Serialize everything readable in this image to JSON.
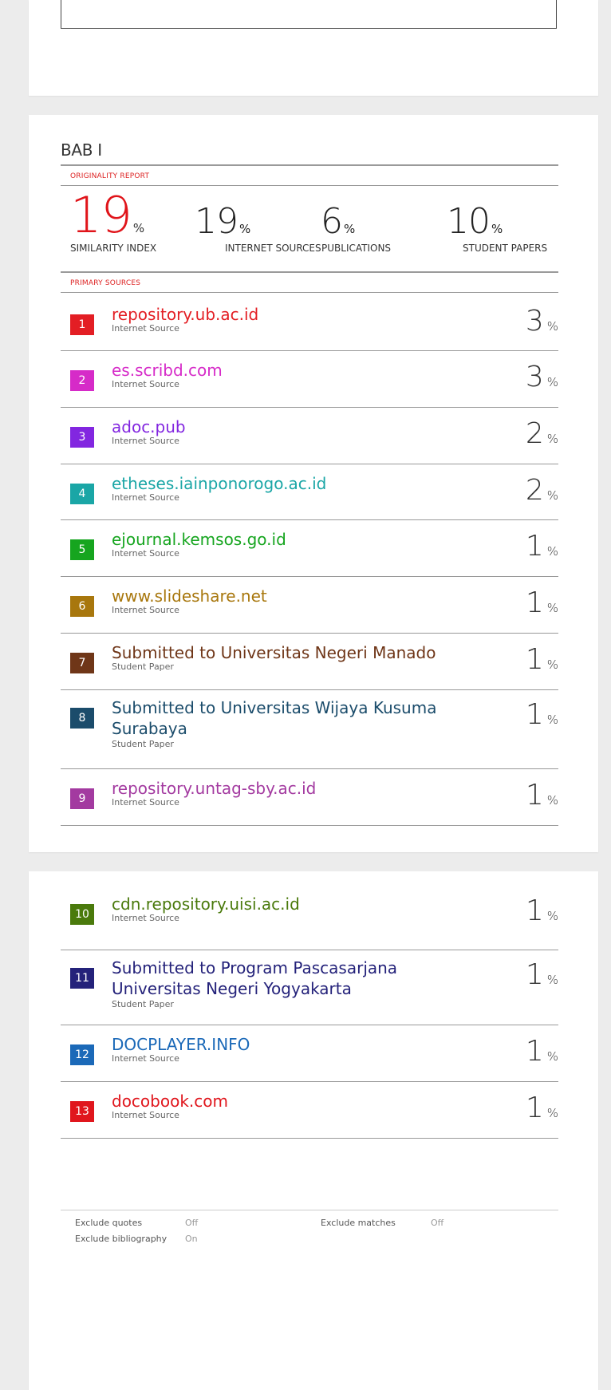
{
  "report": {
    "title": "BAB I",
    "originality_label": "ORIGINALITY REPORT",
    "primary_sources_label": "PRIMARY SOURCES",
    "pct_symbol": "%",
    "stats": [
      {
        "value": "19",
        "label": "SIMILARITY INDEX"
      },
      {
        "value": "19",
        "label": "INTERNET SOURCES"
      },
      {
        "value": "6",
        "label": "PUBLICATIONS"
      },
      {
        "value": "10",
        "label": "STUDENT PAPERS"
      }
    ],
    "sources": [
      {
        "num": "1",
        "name": "repository.ub.ac.id",
        "type": "Internet Source",
        "pct": "3",
        "color": "#e31e24"
      },
      {
        "num": "2",
        "name": "es.scribd.com",
        "type": "Internet Source",
        "pct": "3",
        "color": "#d62bc8"
      },
      {
        "num": "3",
        "name": "adoc.pub",
        "type": "Internet Source",
        "pct": "2",
        "color": "#8226e0"
      },
      {
        "num": "4",
        "name": "etheses.iainponorogo.ac.id",
        "type": "Internet Source",
        "pct": "2",
        "color": "#1aa6a6"
      },
      {
        "num": "5",
        "name": "ejournal.kemsos.go.id",
        "type": "Internet Source",
        "pct": "1",
        "color": "#16a51f"
      },
      {
        "num": "6",
        "name": "www.slideshare.net",
        "type": "Internet Source",
        "pct": "1",
        "color": "#a8770d"
      },
      {
        "num": "7",
        "name": "Submitted to Universitas Negeri Manado",
        "type": "Student Paper",
        "pct": "1",
        "color": "#6f3618"
      },
      {
        "num": "8",
        "name": "Submitted to Universitas Wijaya Kusuma Surabaya",
        "type": "Student Paper",
        "pct": "1",
        "color": "#1b4c6b"
      },
      {
        "num": "9",
        "name": "repository.untag-sby.ac.id",
        "type": "Internet Source",
        "pct": "1",
        "color": "#a33aa0"
      },
      {
        "num": "10",
        "name": "cdn.repository.uisi.ac.id",
        "type": "Internet Source",
        "pct": "1",
        "color": "#4a7a0c"
      },
      {
        "num": "11",
        "name": "Submitted to Program Pascasarjana Universitas Negeri Yogyakarta",
        "type": "Student Paper",
        "pct": "1",
        "color": "#24227a"
      },
      {
        "num": "12",
        "name": "DOCPLAYER.INFO",
        "type": "Internet Source",
        "pct": "1",
        "color": "#1b69b8"
      },
      {
        "num": "13",
        "name": "docobook.com",
        "type": "Internet Source",
        "pct": "1",
        "color": "#e0161d"
      }
    ],
    "footer": {
      "exclude_quotes_label": "Exclude quotes",
      "exclude_quotes_value": "Off",
      "exclude_bibliography_label": "Exclude bibliography",
      "exclude_bibliography_value": "On",
      "exclude_matches_label": "Exclude matches",
      "exclude_matches_value": "Off"
    }
  }
}
